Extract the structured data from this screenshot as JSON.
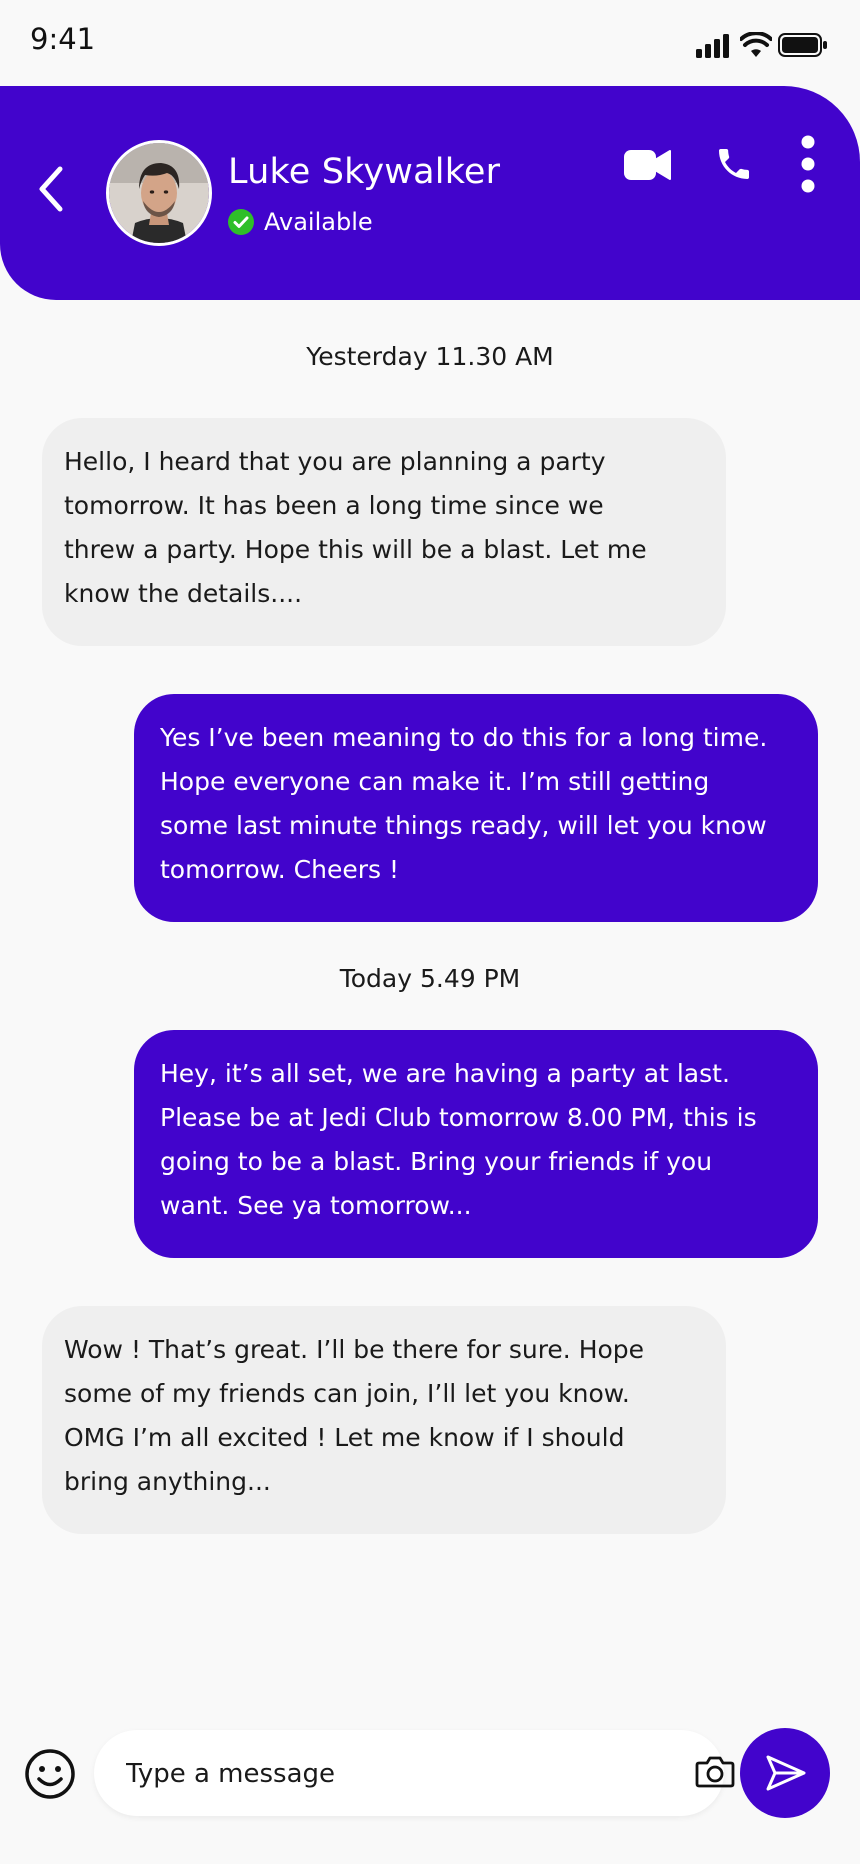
{
  "status_bar": {
    "time": "9:41"
  },
  "header": {
    "contact_name": "Luke Skywalker",
    "status": "Available",
    "icons": [
      "back-icon",
      "video-call-icon",
      "phone-icon",
      "more-options-icon"
    ]
  },
  "messages": [
    {
      "type": "timestamp",
      "text": "Yesterday 11.30 AM"
    },
    {
      "type": "incoming",
      "text": "Hello, I heard that you are planning a party\ntomorrow. It has been a long time since we\nthrew a party. Hope this will be a blast. Let me\nknow the details...."
    },
    {
      "type": "outgoing",
      "text": "Yes I’ve been meaning to do this for a long time.\nHope everyone can make it. I’m still getting\nsome last minute things ready, will let you know\ntomorrow. Cheers !"
    },
    {
      "type": "timestamp",
      "text": "Today 5.49 PM"
    },
    {
      "type": "outgoing",
      "text": "Hey, it’s all set, we are having a party at last.\nPlease be at Jedi Club tomorrow 8.00 PM, this is\ngoing to be a blast. Bring your friends if you\nwant. See ya tomorrow..."
    },
    {
      "type": "incoming",
      "text": "Wow ! That’s great. I’ll be there for sure. Hope\nsome of my friends can join, I’ll let you know.\nOMG I’m all excited ! Let me know if I should\nbring anything..."
    }
  ],
  "composer": {
    "placeholder": "Type a message",
    "icons": [
      "emoji-icon",
      "camera-icon",
      "microphone-icon",
      "send-icon"
    ]
  },
  "colors": {
    "primary": "#4204cc",
    "incoming_bubble": "#efefef",
    "status_green": "#2fbf29",
    "background": "#f9f9f9"
  }
}
